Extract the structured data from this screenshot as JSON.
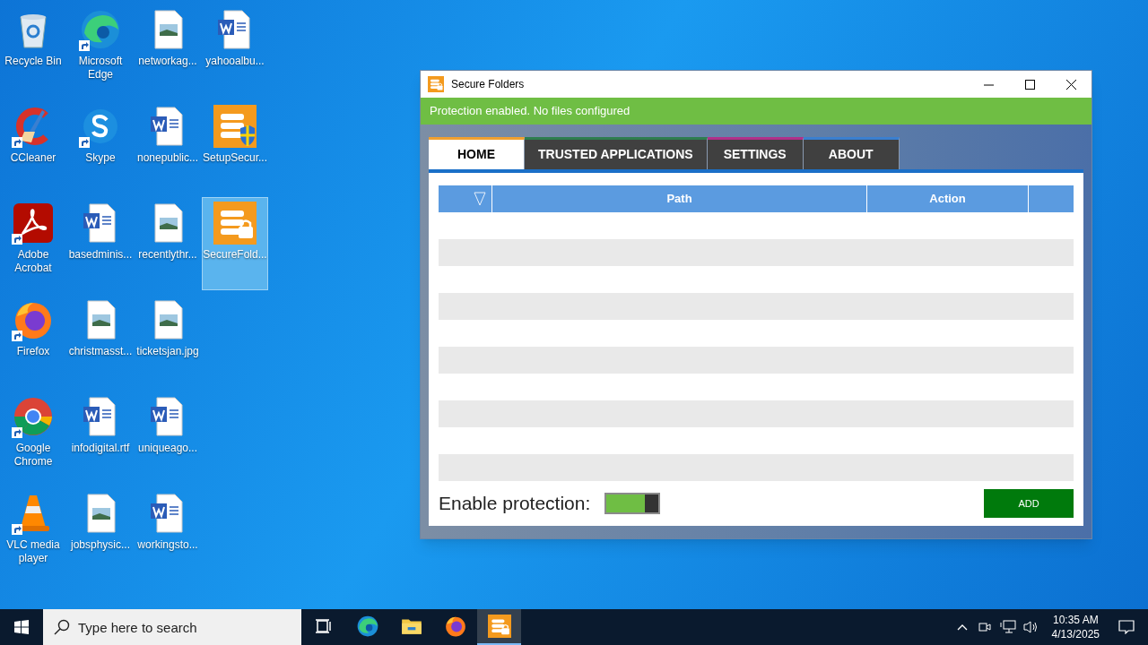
{
  "desktop": {
    "icons": [
      {
        "label": "Recycle Bin",
        "kind": "recycle",
        "shortcut": false,
        "selected": false
      },
      {
        "label": "CCleaner",
        "kind": "ccleaner",
        "shortcut": true,
        "selected": false
      },
      {
        "label": "Adobe Acrobat",
        "kind": "acrobat",
        "shortcut": true,
        "selected": false
      },
      {
        "label": "Firefox",
        "kind": "firefox",
        "shortcut": true,
        "selected": false
      },
      {
        "label": "Google Chrome",
        "kind": "chrome",
        "shortcut": true,
        "selected": false
      },
      {
        "label": "VLC media player",
        "kind": "vlc",
        "shortcut": true,
        "selected": false
      },
      {
        "label": "Microsoft Edge",
        "kind": "edge",
        "shortcut": true,
        "selected": false
      },
      {
        "label": "Skype",
        "kind": "skype",
        "shortcut": true,
        "selected": false
      },
      {
        "label": "basedminis...",
        "kind": "word",
        "shortcut": false,
        "selected": false
      },
      {
        "label": "christmasst...",
        "kind": "image",
        "shortcut": false,
        "selected": false
      },
      {
        "label": "infodigital.rtf",
        "kind": "word",
        "shortcut": false,
        "selected": false
      },
      {
        "label": "jobsphysic...",
        "kind": "image",
        "shortcut": false,
        "selected": false
      },
      {
        "label": "networkag...",
        "kind": "image",
        "shortcut": false,
        "selected": false
      },
      {
        "label": "nonepublic...",
        "kind": "word",
        "shortcut": false,
        "selected": false
      },
      {
        "label": "recentlythr...",
        "kind": "image",
        "shortcut": false,
        "selected": false
      },
      {
        "label": "ticketsjan.jpg",
        "kind": "image",
        "shortcut": false,
        "selected": false
      },
      {
        "label": "uniqueago...",
        "kind": "word",
        "shortcut": false,
        "selected": false
      },
      {
        "label": "workingsto...",
        "kind": "word",
        "shortcut": false,
        "selected": false
      },
      {
        "label": "yahooalbu...",
        "kind": "word",
        "shortcut": false,
        "selected": false
      },
      {
        "label": "SetupSecur...",
        "kind": "setup",
        "shortcut": false,
        "selected": false
      },
      {
        "label": "SecureFold...",
        "kind": "securefolders",
        "shortcut": false,
        "selected": true
      }
    ]
  },
  "window": {
    "title": "Secure Folders",
    "status": {
      "text": "Protection enabled. No files configured",
      "color": "#6fbe44"
    },
    "tabs": [
      {
        "label": "HOME",
        "selected": true,
        "color": "#f0a030"
      },
      {
        "label": "TRUSTED APPLICATIONS",
        "selected": false,
        "color": "#2e7d4f"
      },
      {
        "label": "SETTINGS",
        "selected": false,
        "color": "#b0308a"
      },
      {
        "label": "ABOUT",
        "selected": false,
        "color": "#3a7fd0"
      }
    ],
    "table": {
      "columns": [
        "Path",
        "Action"
      ]
    },
    "protection": {
      "label": "Enable protection:",
      "on": true
    },
    "add_button": "ADD"
  },
  "taskbar": {
    "search": {
      "placeholder": "Type here to search"
    },
    "apps": [
      {
        "kind": "taskview",
        "active": false
      },
      {
        "kind": "edge",
        "active": false
      },
      {
        "kind": "folder",
        "active": false
      },
      {
        "kind": "firefox",
        "active": false
      },
      {
        "kind": "securefolders",
        "active": true
      }
    ],
    "time": "10:35 AM",
    "date": "4/13/2025"
  }
}
